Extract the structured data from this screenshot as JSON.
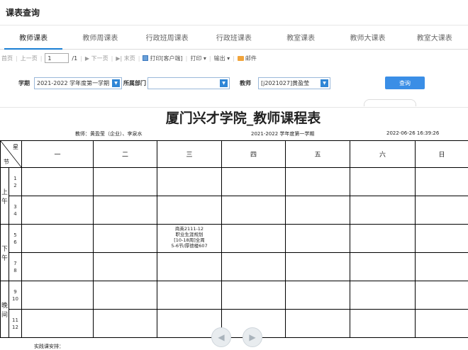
{
  "app": {
    "title": "课表查询"
  },
  "tabs": [
    {
      "label": "教师课表",
      "active": true
    },
    {
      "label": "教师周课表",
      "active": false
    },
    {
      "label": "行政班周课表",
      "active": false
    },
    {
      "label": "行政班课表",
      "active": false
    },
    {
      "label": "教室课表",
      "active": false
    },
    {
      "label": "教师大课表",
      "active": false
    },
    {
      "label": "教室大课表",
      "active": false
    }
  ],
  "toolbar": {
    "first": "首页",
    "prev": "上一页",
    "page_value": "1",
    "page_total": "/1",
    "next": "▶ 下一页",
    "last": "▶| 末页",
    "print_client": "打印[客户端]",
    "print": "打印 ▾",
    "export": "输出 ▾",
    "mail": "邮件"
  },
  "filters": {
    "term_label": "学期",
    "term_value": "2021-2022 学年度第一学期",
    "dept_label": "所属部门",
    "dept_value": "",
    "teacher_label": "教师",
    "teacher_value": "[j2021027]黄盈莹",
    "query_label": "查询"
  },
  "report": {
    "title": "厦门兴才学院_教师课程表",
    "teacher": "教师：黄盈莹（企业）、李泉水",
    "term": "2021-2022 学年度第一学期",
    "timestamp": "2022-06-26 16:39:26",
    "corner_day": "星",
    "corner_period": "节",
    "days": [
      "一",
      "二",
      "三",
      "四",
      "五",
      "六",
      "日"
    ],
    "sections": [
      {
        "label": "上\n午",
        "slots": [
          [
            "1",
            "2"
          ],
          [
            "3",
            "4"
          ]
        ]
      },
      {
        "label": "下\n午",
        "slots": [
          [
            "5",
            "6"
          ],
          [
            "7",
            "8"
          ]
        ]
      },
      {
        "label": "晚\n间",
        "slots": [
          [
            "9",
            "10"
          ],
          [
            "11",
            "12"
          ]
        ]
      }
    ],
    "course": {
      "line1": "商英2111-12",
      "line2": "职业生涯规划",
      "line3": "[10-18周]全周",
      "line4": "5-6节/厚德楼607"
    },
    "footnote": "实践课安排："
  },
  "icons": {
    "prev_arrow": "arrow-left-icon",
    "next_arrow": "arrow-right-icon"
  }
}
